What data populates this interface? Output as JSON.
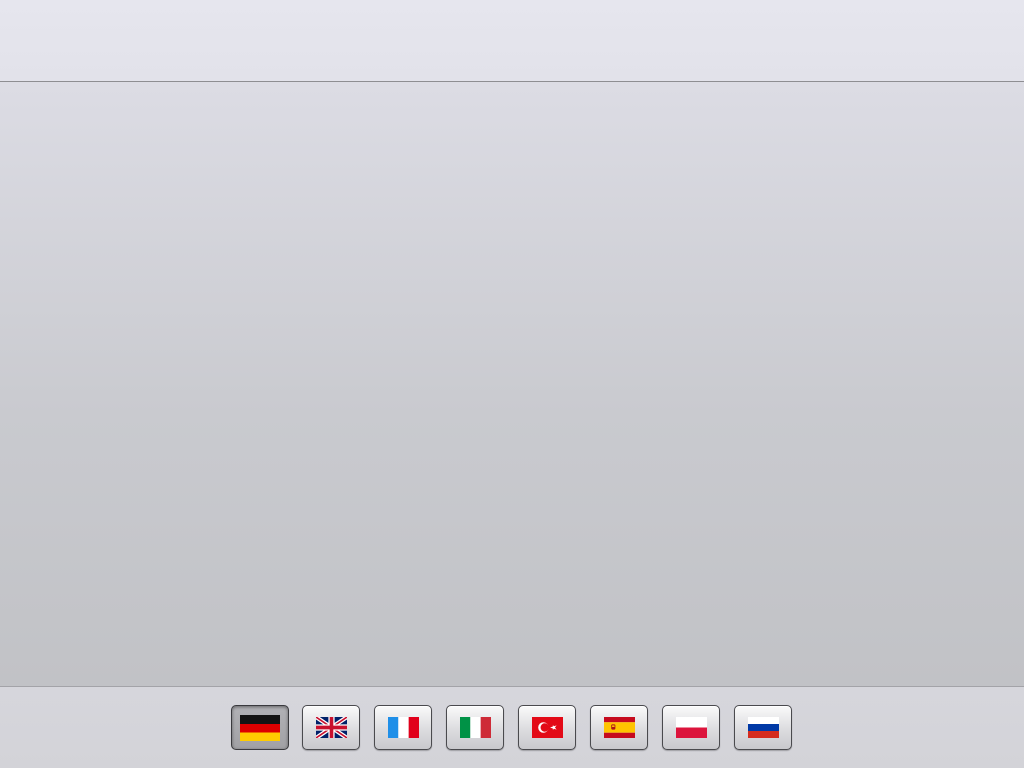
{
  "languages": [
    {
      "code": "de",
      "icon": "german-flag-icon",
      "selected": true
    },
    {
      "code": "en",
      "icon": "uk-flag-icon",
      "selected": false
    },
    {
      "code": "fr",
      "icon": "french-flag-icon",
      "selected": false
    },
    {
      "code": "it",
      "icon": "italian-flag-icon",
      "selected": false
    },
    {
      "code": "tr",
      "icon": "turkish-flag-icon",
      "selected": false
    },
    {
      "code": "es",
      "icon": "spanish-flag-icon",
      "selected": false
    },
    {
      "code": "pl",
      "icon": "polish-flag-icon",
      "selected": false
    },
    {
      "code": "ru",
      "icon": "russian-flag-icon",
      "selected": false
    }
  ],
  "colors": {
    "top_bar": "#e4e4ec",
    "content_top": "#dcdce4",
    "content_bottom": "#c1c2c6",
    "bottom_bar": "#d5d5da",
    "button_border": "#4a4a4e"
  }
}
